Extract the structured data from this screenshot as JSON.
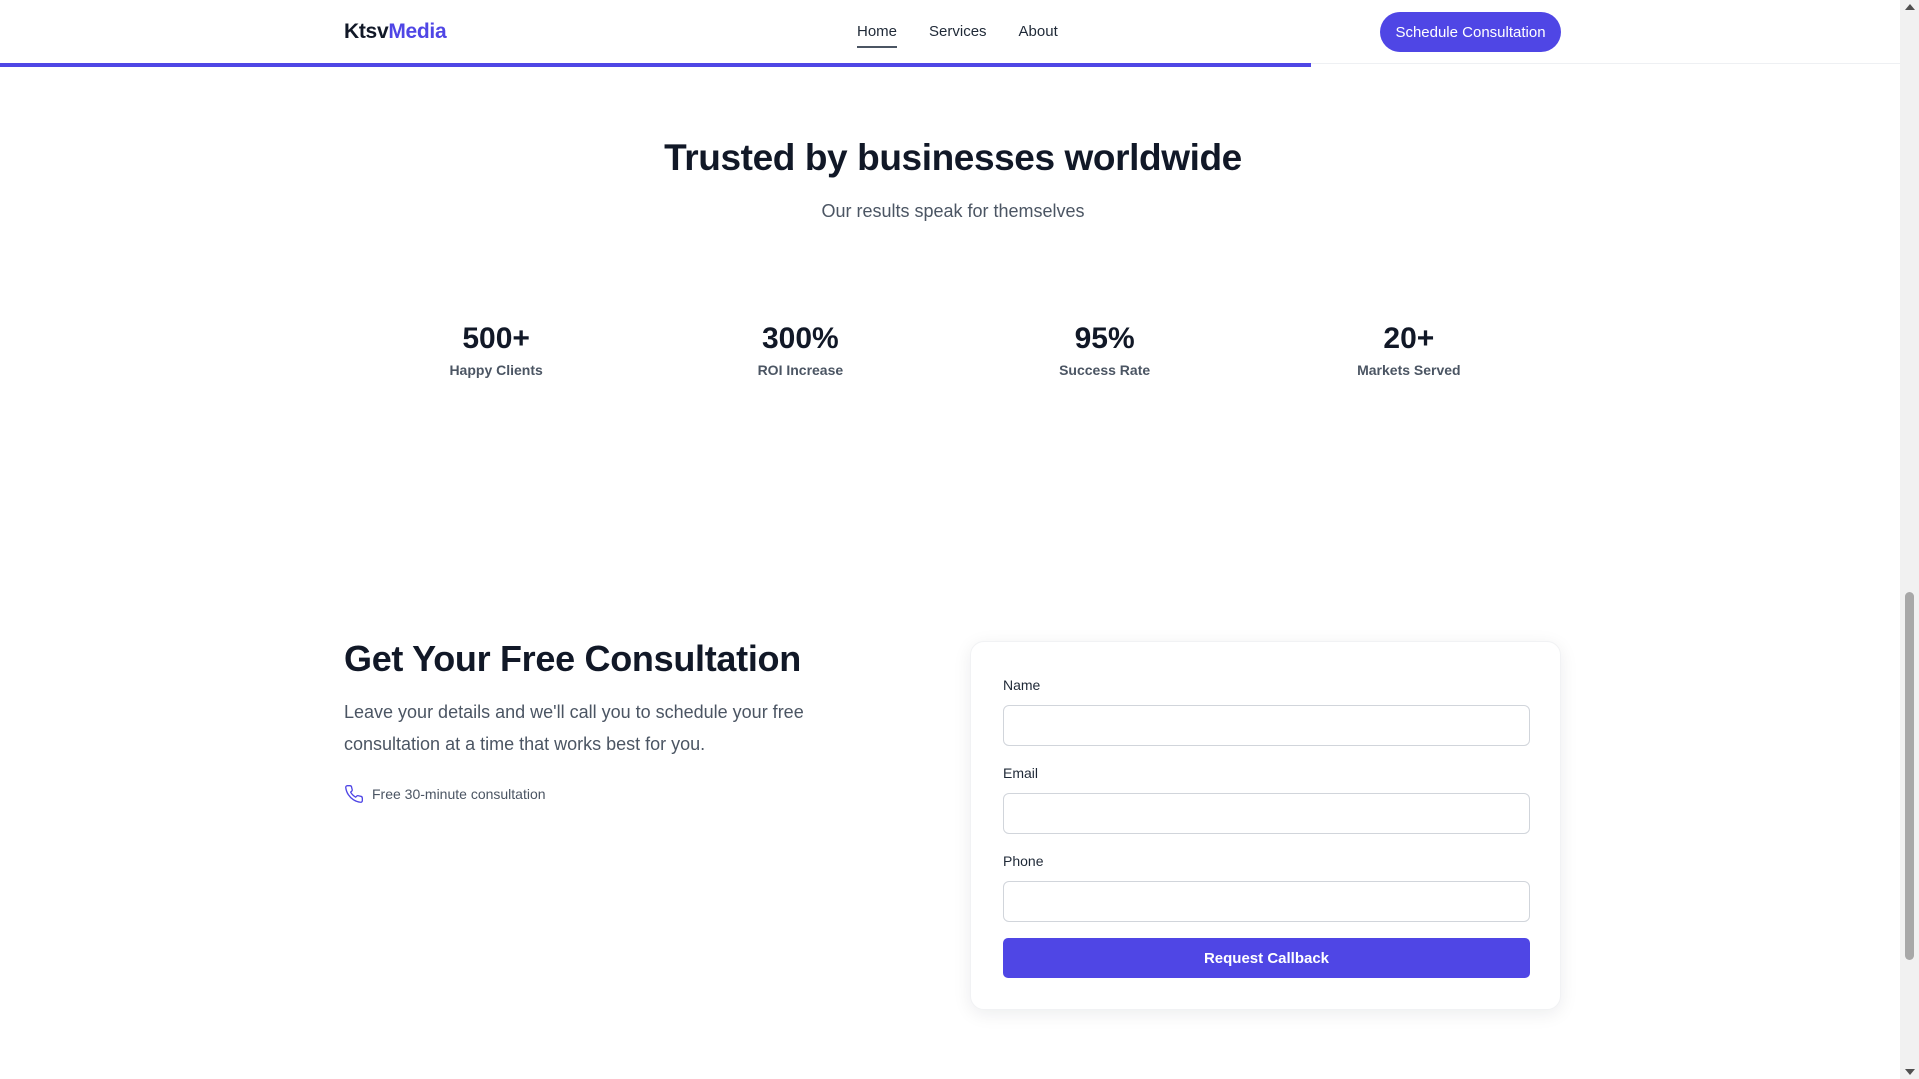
{
  "header": {
    "logo_part1": "Ktsv",
    "logo_part2": "Media",
    "nav": [
      "Home",
      "Services",
      "About"
    ],
    "active_nav": "Home",
    "cta_label": "Schedule Consultation",
    "scroll_progress_percent": 69
  },
  "stats": {
    "title": "Trusted by businesses worldwide",
    "subtitle": "Our results speak for themselves",
    "items": [
      {
        "value": "500+",
        "label": "Happy Clients"
      },
      {
        "value": "300%",
        "label": "ROI Increase"
      },
      {
        "value": "95%",
        "label": "Success Rate"
      },
      {
        "value": "20+",
        "label": "Markets Served"
      }
    ]
  },
  "consultation": {
    "title": "Get Your Free Consultation",
    "description": "Leave your details and we'll call you to schedule your free consultation at a time that works best for you.",
    "note": "Free 30-minute consultation",
    "note_icon": "phone-icon",
    "form": {
      "name_label": "Name",
      "name_value": "",
      "email_label": "Email",
      "email_value": "",
      "phone_label": "Phone",
      "phone_value": "",
      "submit_label": "Request Callback"
    }
  },
  "colors": {
    "accent": "#4f46e5",
    "heading": "#111827",
    "muted": "#4b5563"
  }
}
